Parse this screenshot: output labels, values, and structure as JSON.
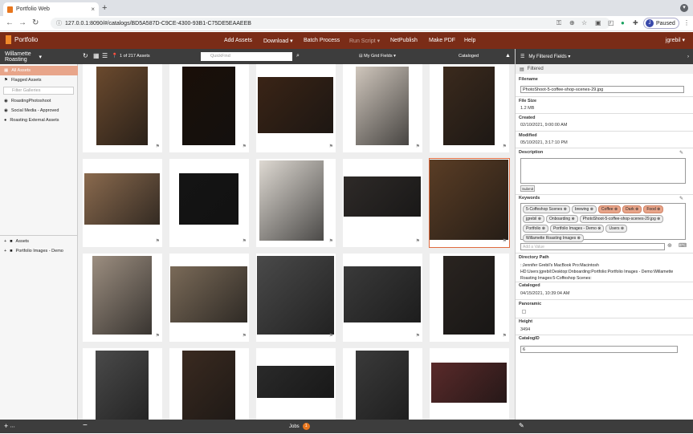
{
  "browser": {
    "tab_title": "Portfolio Web",
    "url": "127.0.0.1:8090/#/catalogs/BD5A587D-C9CE-4300-93B1-C75DE5EAAEEB",
    "profile_initial": "J",
    "profile_status": "Paused"
  },
  "header": {
    "logo": "Portfolio",
    "menu": [
      "Add Assets",
      "Download",
      "Batch Process",
      "Run Script",
      "NetPublish",
      "Make PDF",
      "Help"
    ],
    "user": "jgrebil"
  },
  "left": {
    "catalog": "Willamette Roasting",
    "items": [
      "All Assets",
      "Flagged Assets"
    ],
    "filter_placeholder": "Filter Galleries",
    "galleries": [
      "RoastingPhotoshoot",
      "Social Media - Approved",
      "Roasting External Assets"
    ],
    "folders": [
      "Assets",
      "Portfolio Images - Demo"
    ]
  },
  "toolbar": {
    "count": "1 of 217 Assets",
    "search_placeholder": "QuickFind",
    "grid_fields": "My Grid Fields",
    "sort": "Cataloged"
  },
  "footer": {
    "jobs": "Jobs",
    "jobs_count": "1"
  },
  "right": {
    "title": "My Filtered Fields",
    "filter": "Filtered",
    "filename_label": "Filename",
    "filename": "PhotoShoot-5-coffee-shop-scenes-29.jpg",
    "filesize_label": "File Size",
    "filesize": "1.2 MB",
    "created_label": "Created",
    "created": "02/10/2021, 9:00:00 AM",
    "modified_label": "Modified",
    "modified": "05/10/2021, 3:17:10 PM",
    "description_label": "Description",
    "submit": "Submit",
    "keywords_label": "Keywords",
    "keywords": [
      "5-Coffeshop Scenes",
      "brewing",
      "Coffee",
      "Dark",
      "Food",
      "jgrebil",
      "Onboarding",
      "PhotoShoot-5-coffee-shop-scenes-29.jpg",
      "Portfolio",
      "Portfolio Images - Demo",
      "Users",
      "Willamette Roasting Images"
    ],
    "add_value": "Add a Value",
    "dirpath_label": "Directory Path",
    "dirpath": "::Jennifer Grebil's MacBook Pro:Macintosh HD:Users:jgrebil:Desktop:Onboarding:Portfolio:Portfolio Images - Demo:Willamette Roasting Images:5-Coffeshop Scenes:",
    "cataloged_label": "Cataloged",
    "cataloged": "04/15/2021, 10:39:04 AM",
    "panoramic_label": "Panoramic",
    "height_label": "Height",
    "height": "3494",
    "catalogid_label": "CatalogID",
    "catalogid": "6"
  },
  "colors": {
    "header": "#7a2c17",
    "accent": "#e8761d",
    "selected": "#e8a58a",
    "dark": "#3d3d3d"
  },
  "grid_photos": [
    [
      "#6b4a2e",
      "#1a0f08",
      "#3a2416",
      "#cfc6bc",
      "#3b2a1d"
    ],
    [
      "#8a6a4e",
      "#141414",
      "#ded9d2",
      "#2e2a28",
      "#5a3d25"
    ],
    [
      "#9c8e80",
      "#7a6a58",
      "#4a4a4a",
      "#3a3a3a",
      "#2a2420"
    ],
    [
      "#4a4a4a",
      "#3a2a20",
      "#2a2a2a",
      "#3a3a3a",
      "#5a2a2a"
    ]
  ]
}
